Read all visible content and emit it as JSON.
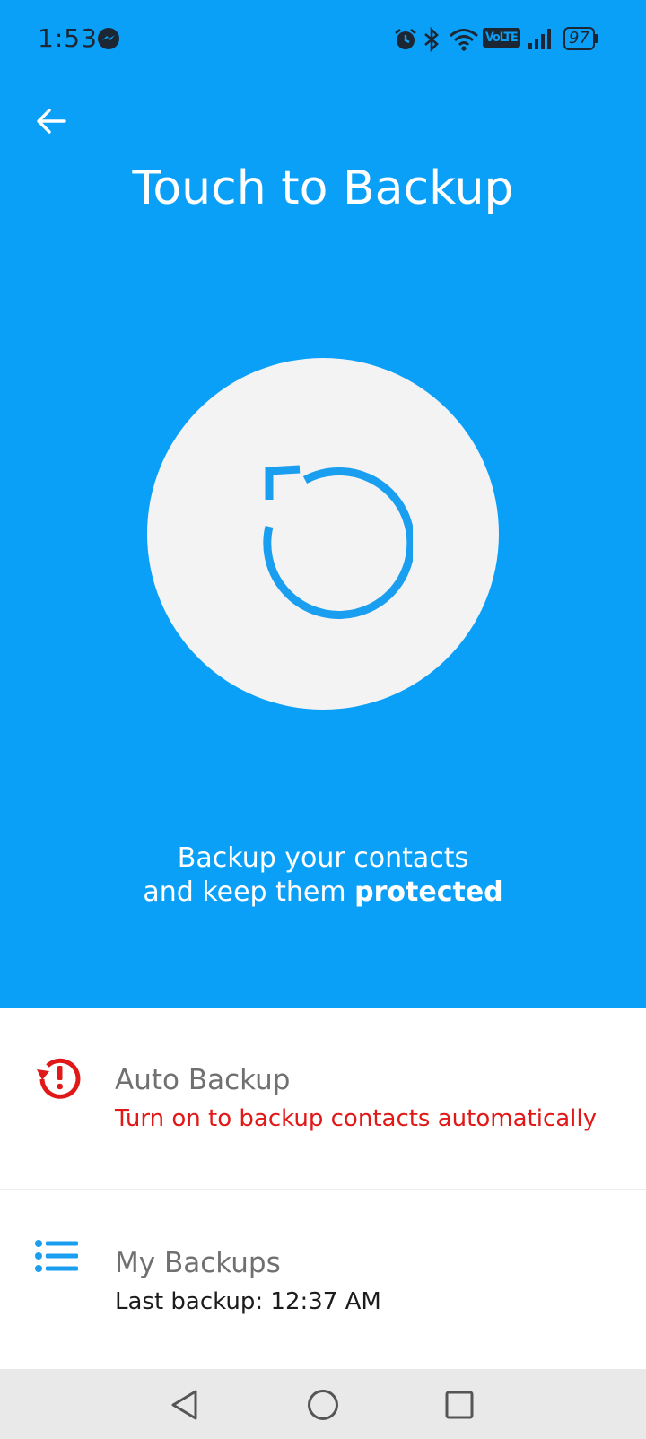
{
  "status_bar": {
    "time": "1:53",
    "network_label": "VoLTE",
    "battery": "97",
    "icons": [
      "messenger-icon",
      "alarm-icon",
      "bluetooth-icon",
      "wifi-icon",
      "volte-icon",
      "signal-icon",
      "battery-icon"
    ]
  },
  "header": {
    "back_icon": "arrow-left-icon",
    "title": "Touch to Backup"
  },
  "backup_button": {
    "icon": "restore-icon"
  },
  "tagline": {
    "line1": "Backup your contacts",
    "line2_prefix": "and keep them ",
    "line2_bold": "protected"
  },
  "list": {
    "auto_backup": {
      "title": "Auto Backup",
      "subtitle": "Turn on to backup contacts automatically",
      "icon": "history-alert-icon"
    },
    "my_backups": {
      "title": "My Backups",
      "subtitle": "Last backup: 12:37 AM",
      "icon": "list-icon"
    }
  },
  "nav_bar": {
    "icons": [
      "back-triangle-icon",
      "home-circle-icon",
      "recents-square-icon"
    ]
  },
  "colors": {
    "hero_blue": "#0aa0f8",
    "accent_blue": "#1a9ef0",
    "alert_red": "#e01818",
    "circle_bg": "#f3f3f3"
  }
}
